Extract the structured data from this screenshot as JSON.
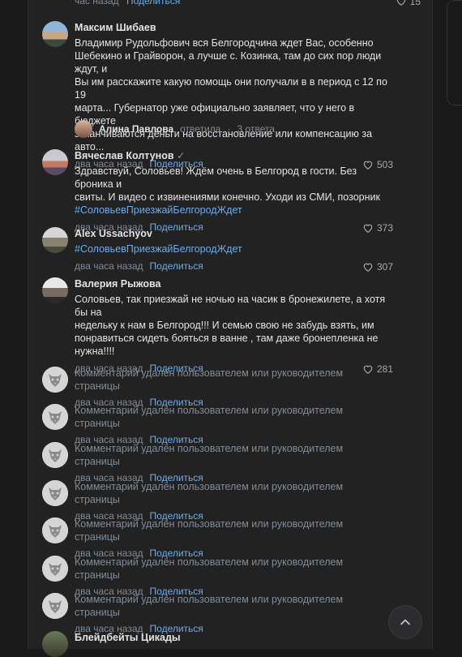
{
  "top_meta": {
    "time": "час назад",
    "share": "Поделиться",
    "likes": "15"
  },
  "comments": [
    {
      "name": "Максим Шибаев",
      "lines": [
        "Владимир Рудольфович вся Белгородчина ждет Вас, особенно",
        "Шебекино и Грайворон, а лучше с. Козинка, там до сих пор люди ждут, и",
        "Вы им расскажите какую помощь они получали в в период с 12 по 19",
        "марта... Губернатор уже официально заявляет, что у него в бюджете",
        "заканчиваются деньги на восстановление или компенсацию за авто..."
      ],
      "time": "два часа назад",
      "share": "Поделиться",
      "likes": "503"
    },
    {
      "name": "Вячеслав Колтунов",
      "lines": [
        "Здравствуй, Соловьев! Ждём очень в Белгород в гости. Без броника и",
        "свиты. И видео с извинениями конечно. Уходи из СМИ, позорник"
      ],
      "tag": "#СоловьевПриезжайБелгородЖдет",
      "time": "два часа назад",
      "share": "Поделиться",
      "likes": "373"
    },
    {
      "name": "Alex Ussachyov",
      "tag": "#СоловьевПриезжайБелгородЖдет",
      "time": "два часа назад",
      "share": "Поделиться",
      "likes": "307"
    },
    {
      "name": "Валерия Рыжова",
      "lines": [
        "Соловьев, так приезжай не ночью на часик в бронежилете, а хотя бы на",
        "недельку к нам в Белгород!!! И семью свою не забудь взять, им",
        "понравиться сидеть бояться в ванне , там даже бронепленка не",
        "нужна!!!!"
      ],
      "time": "два часа назад",
      "share": "Поделиться",
      "likes": "281"
    }
  ],
  "reply": {
    "name": "Алина Павлова",
    "action": "ответила",
    "sep": "·",
    "count": "3 ответа"
  },
  "deleted": {
    "text": "Комментарий удалён пользователем или руководителем страницы",
    "time": "два часа назад",
    "share": "Поделиться"
  },
  "last": {
    "name": "Блейдбейты Цикады"
  },
  "colors": {
    "bg": "#19191a",
    "panel": "#222222",
    "link": "#71aaeb",
    "muted": "#818c99"
  }
}
